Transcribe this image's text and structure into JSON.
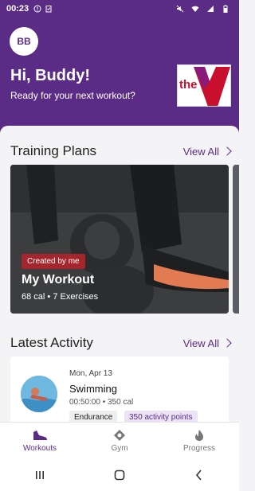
{
  "status_bar": {
    "time": "00:23",
    "icons_left": [
      "alert-circle-icon",
      "clipboard-icon"
    ],
    "icons_right": [
      "mute-icon",
      "wifi-icon",
      "signal-icon",
      "battery-icon"
    ]
  },
  "header": {
    "avatar_initials": "BB",
    "greeting": "Hi, Buddy!",
    "subtitle": "Ready for your next workout?",
    "logo_text": "the"
  },
  "training_plans": {
    "title": "Training Plans",
    "view_all": "View All",
    "card": {
      "badge": "Created by me",
      "name": "My Workout",
      "meta": "68 cal • 7 Exercises"
    }
  },
  "latest_activity": {
    "title": "Latest Activity",
    "view_all": "View All",
    "item": {
      "date": "Mon, Apr 13",
      "name": "Swimming",
      "meta": "00:50:00 • 350 cal",
      "tag1": "Endurance",
      "tag2": "350 activity points"
    }
  },
  "bottom_nav": [
    {
      "label": "Workouts",
      "icon": "shoe-icon",
      "active": true
    },
    {
      "label": "Gym",
      "icon": "location-pin-icon",
      "active": false
    },
    {
      "label": "Progress",
      "icon": "flame-icon",
      "active": false
    }
  ],
  "colors": {
    "brand": "#5b2c86",
    "badge": "#a4262c",
    "logo_red": "#c8102e"
  }
}
